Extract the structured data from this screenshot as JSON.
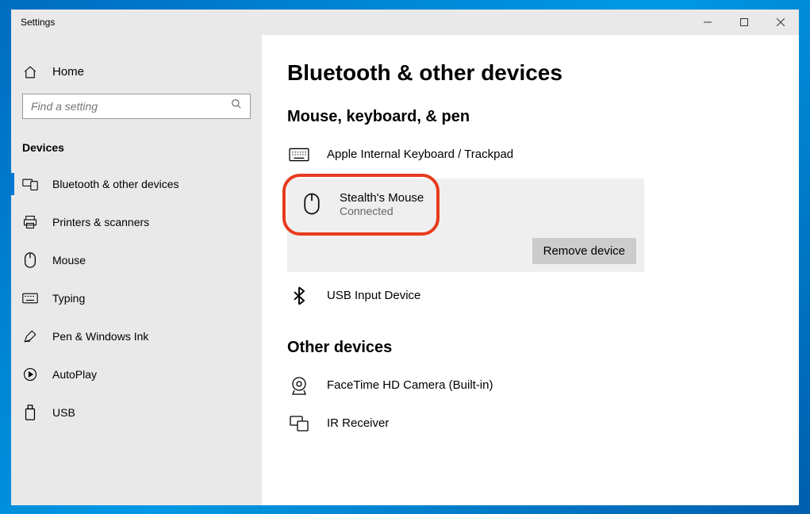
{
  "window": {
    "title": "Settings"
  },
  "sidebar": {
    "home_label": "Home",
    "search_placeholder": "Find a setting",
    "section_label": "Devices",
    "items": [
      {
        "label": "Bluetooth & other devices",
        "icon": "devices-icon",
        "active": true
      },
      {
        "label": "Printers & scanners",
        "icon": "printer-icon",
        "active": false
      },
      {
        "label": "Mouse",
        "icon": "mouse-icon",
        "active": false
      },
      {
        "label": "Typing",
        "icon": "keyboard-icon",
        "active": false
      },
      {
        "label": "Pen & Windows Ink",
        "icon": "pen-icon",
        "active": false
      },
      {
        "label": "AutoPlay",
        "icon": "autoplay-icon",
        "active": false
      },
      {
        "label": "USB",
        "icon": "usb-icon",
        "active": false
      }
    ]
  },
  "main": {
    "page_title": "Bluetooth & other devices",
    "groups": [
      {
        "title": "Mouse, keyboard, & pen",
        "devices": [
          {
            "name": "Apple Internal Keyboard / Trackpad",
            "status": "",
            "icon": "keyboard-icon",
            "selected": false,
            "highlighted": false
          },
          {
            "name": "Stealth's Mouse",
            "status": "Connected",
            "icon": "mouse-icon",
            "selected": true,
            "highlighted": true
          },
          {
            "name": "USB Input Device",
            "status": "",
            "icon": "bluetooth-icon",
            "selected": false,
            "highlighted": false
          }
        ]
      },
      {
        "title": "Other devices",
        "devices": [
          {
            "name": "FaceTime HD Camera (Built-in)",
            "status": "",
            "icon": "camera-icon",
            "selected": false,
            "highlighted": false
          },
          {
            "name": "IR Receiver",
            "status": "",
            "icon": "generic-device-icon",
            "selected": false,
            "highlighted": false
          }
        ]
      }
    ],
    "remove_label": "Remove device"
  }
}
